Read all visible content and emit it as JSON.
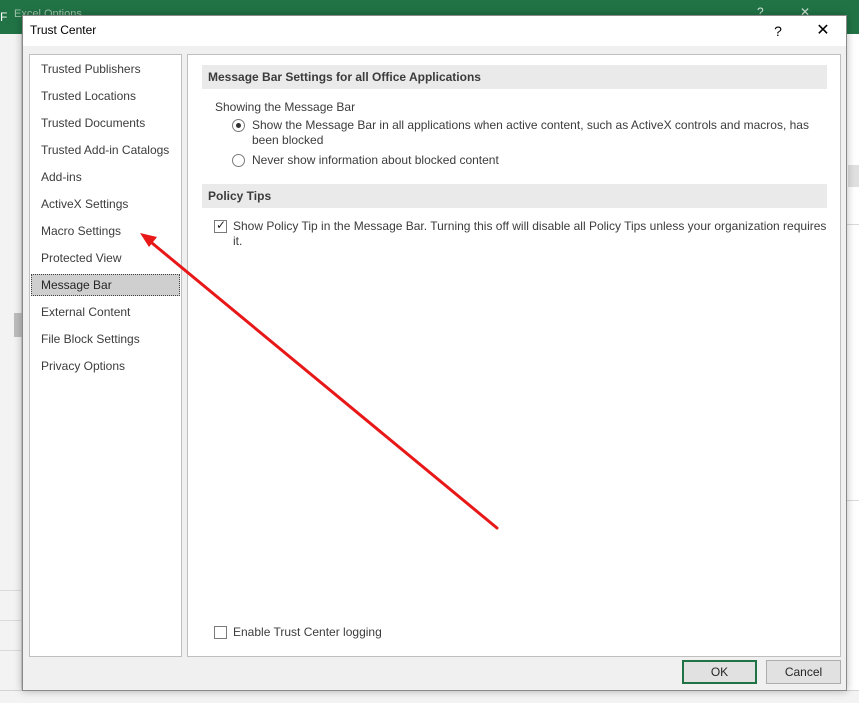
{
  "background_window": {
    "title": "Excel Options",
    "app_letter": "F",
    "help_glyph": "?",
    "close_glyph": "✕"
  },
  "dialog": {
    "title": "Trust Center",
    "help_glyph": "?",
    "close_glyph": "✕"
  },
  "nav": {
    "items": [
      {
        "label": "Trusted Publishers"
      },
      {
        "label": "Trusted Locations"
      },
      {
        "label": "Trusted Documents"
      },
      {
        "label": "Trusted Add-in Catalogs"
      },
      {
        "label": "Add-ins"
      },
      {
        "label": "ActiveX Settings"
      },
      {
        "label": "Macro Settings"
      },
      {
        "label": "Protected View"
      },
      {
        "label": "Message Bar"
      },
      {
        "label": "External Content"
      },
      {
        "label": "File Block Settings"
      },
      {
        "label": "Privacy Options"
      }
    ],
    "selected": "Message Bar"
  },
  "content": {
    "message_bar_section": {
      "header": "Message Bar Settings for all Office Applications",
      "group_label": "Showing the Message Bar",
      "option_show": {
        "label": "Show the Message Bar in all applications when active content, such as ActiveX controls and macros, has been blocked",
        "selected": true
      },
      "option_never": {
        "label": "Never show information about blocked content",
        "selected": false
      }
    },
    "policy_tips_section": {
      "header": "Policy Tips",
      "checkbox": {
        "label": "Show Policy Tip in the Message Bar. Turning this off will disable all Policy Tips unless your organization requires it.",
        "checked": true,
        "check_glyph": "✓"
      }
    },
    "logging": {
      "label": "Enable Trust Center logging",
      "checked": false
    }
  },
  "buttons": {
    "ok": "OK",
    "cancel": "Cancel"
  },
  "annotation": {
    "type": "arrow",
    "color": "#e81818",
    "points_to": "Macro Settings"
  },
  "colors": {
    "excel_green": "#217346",
    "selected_nav": "#cfcfcf"
  }
}
